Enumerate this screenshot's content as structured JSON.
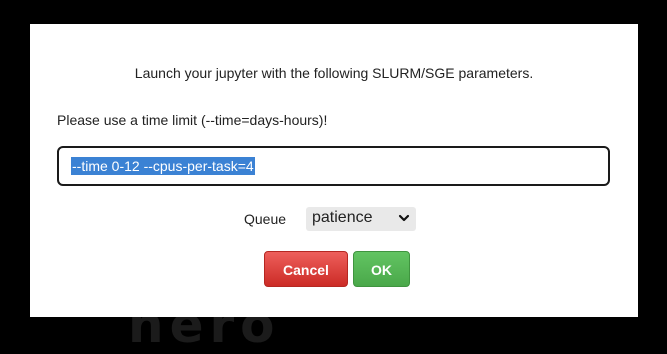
{
  "background": {
    "logo_text": "hero",
    "color": "#000000"
  },
  "dialog": {
    "headline": "Launch your jupyter with the following SLURM/SGE parameters.",
    "hint": "Please use a time limit (--time=days-hours)!",
    "param_input": {
      "value": "--time 0-12 --cpus-per-task=4",
      "selected": true
    },
    "queue": {
      "label": "Queue",
      "selected": "patience"
    },
    "buttons": {
      "cancel_label": "Cancel",
      "ok_label": "OK"
    }
  },
  "colors": {
    "cancel": "#da4f49",
    "ok": "#5bb75b",
    "selection": "#3b82d4"
  },
  "icons": {
    "queue_dropdown": "chevron-down-icon"
  }
}
